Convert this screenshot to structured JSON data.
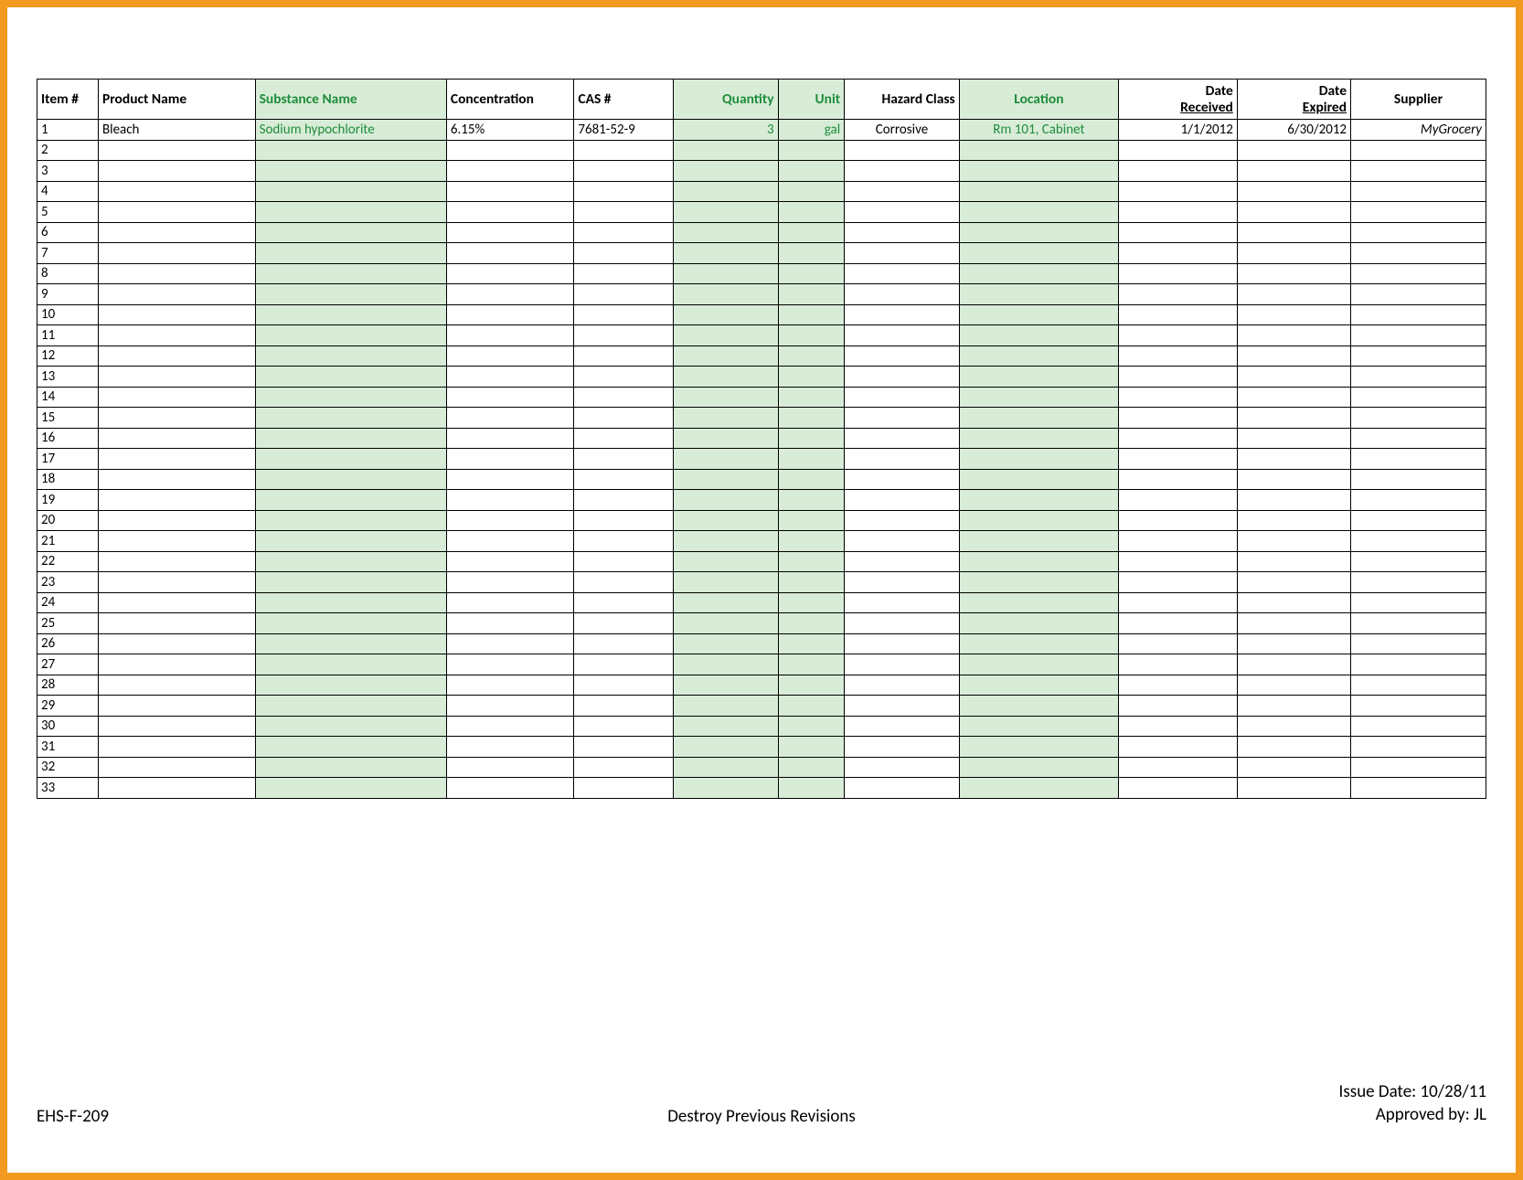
{
  "table": {
    "headers": {
      "item": "Item #",
      "product": "Product Name",
      "substance": "Substance Name",
      "concentration": "Concentration",
      "cas": "CAS #",
      "quantity": "Quantity",
      "unit": "Unit",
      "hazard": "Hazard Class",
      "location": "Location",
      "date_received_l1": "Date",
      "date_received_l2": "Received",
      "date_expired_l1": "Date",
      "date_expired_l2": "Expired",
      "supplier": "Supplier"
    },
    "rows": [
      {
        "item": "1",
        "product": "Bleach",
        "substance": "Sodium hypochlorite",
        "concentration": "6.15%",
        "cas": "7681-52-9",
        "quantity": "3",
        "unit": "gal",
        "hazard": "Corrosive",
        "location": "Rm 101, Cabinet",
        "date_received": "1/1/2012",
        "date_expired": "6/30/2012",
        "supplier": "MyGrocery"
      },
      {
        "item": "2"
      },
      {
        "item": "3"
      },
      {
        "item": "4"
      },
      {
        "item": "5"
      },
      {
        "item": "6"
      },
      {
        "item": "7"
      },
      {
        "item": "8"
      },
      {
        "item": "9"
      },
      {
        "item": "10"
      },
      {
        "item": "11"
      },
      {
        "item": "12"
      },
      {
        "item": "13"
      },
      {
        "item": "14"
      },
      {
        "item": "15"
      },
      {
        "item": "16"
      },
      {
        "item": "17"
      },
      {
        "item": "18"
      },
      {
        "item": "19"
      },
      {
        "item": "20"
      },
      {
        "item": "21"
      },
      {
        "item": "22"
      },
      {
        "item": "23"
      },
      {
        "item": "24"
      },
      {
        "item": "25"
      },
      {
        "item": "26"
      },
      {
        "item": "27"
      },
      {
        "item": "28"
      },
      {
        "item": "29"
      },
      {
        "item": "30"
      },
      {
        "item": "31"
      },
      {
        "item": "32"
      },
      {
        "item": "33"
      }
    ]
  },
  "footer": {
    "form_id": "EHS-F-209",
    "center_note": "Destroy Previous Revisions",
    "issue_date_label": "Issue Date: 10/28/11",
    "approved_by_label": "Approved by: JL"
  }
}
